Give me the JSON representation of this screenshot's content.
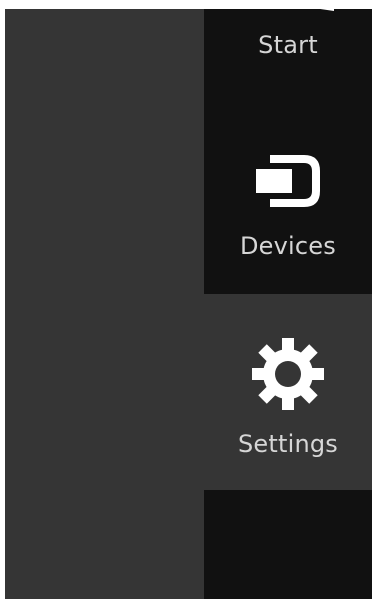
{
  "charms": {
    "items": [
      {
        "id": "start",
        "label": "Start",
        "icon": "windows-logo-icon"
      },
      {
        "id": "devices",
        "label": "Devices",
        "icon": "devices-icon"
      },
      {
        "id": "settings",
        "label": "Settings",
        "icon": "gear-icon",
        "state": "hovered"
      }
    ]
  },
  "colors": {
    "desktop_background": "#353535",
    "charm_bar_background": "#111111",
    "charm_highlight": "#353535",
    "label_text": "#d6d6d6",
    "icon": "#ffffff"
  }
}
